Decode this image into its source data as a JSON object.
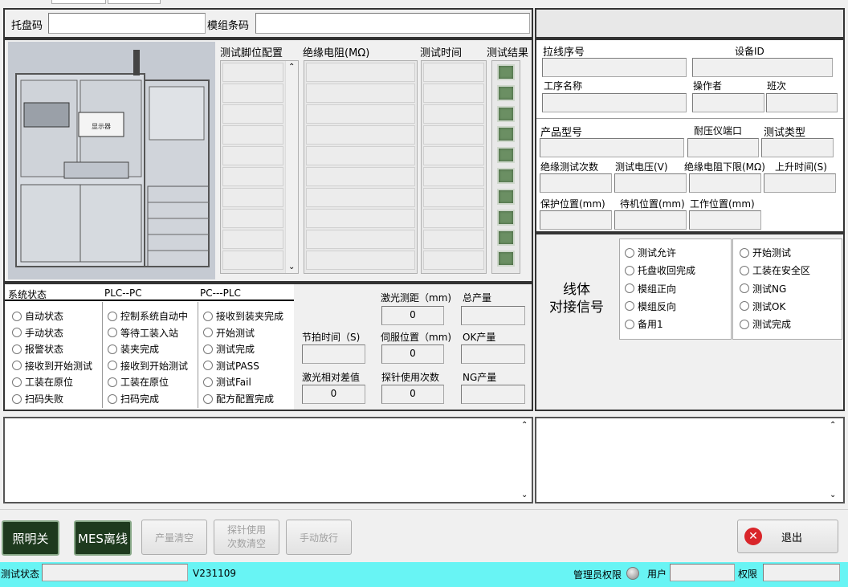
{
  "top": {
    "tray_label": "托盘码",
    "module_label": "模组条码"
  },
  "table": {
    "headers": [
      "测试脚位配置",
      "绝缘电阻(MΩ)",
      "测试时间",
      "测试结果"
    ],
    "rows": 10
  },
  "image": {
    "screen_text": "显示器"
  },
  "status": {
    "col1_title": "系统状态",
    "col2_title": "PLC--PC",
    "col3_title": "PC---PLC",
    "col1": [
      "自动状态",
      "手动状态",
      "报警状态",
      "接收到开始测试",
      "工装在原位",
      "扫码失败"
    ],
    "col2": [
      "控制系统自动中",
      "等待工装入站",
      "装夹完成",
      "接收到开始测试",
      "工装在原位",
      "扫码完成"
    ],
    "col3": [
      "接收到装夹完成",
      "开始测试",
      "测试完成",
      "测试PASS",
      "测试Fail",
      "配方配置完成"
    ]
  },
  "metrics": {
    "beat_label": "节拍时间（S)",
    "beat_value": "",
    "laser_label": "激光测距（mm)",
    "laser_value": "0",
    "total_label": "总产量",
    "total_value": "",
    "servo_label": "伺服位置（mm)",
    "servo_value": "0",
    "ok_label": "OK产量",
    "ok_value": "",
    "laser_diff_label": "激光相对差值",
    "laser_diff_value": "0",
    "probe_label": "探针使用次数",
    "probe_value": "0",
    "ng_label": "NG产量",
    "ng_value": ""
  },
  "info": {
    "line_seq": "拉线序号",
    "device_id": "设备ID",
    "process_name": "工序名称",
    "operator": "操作者",
    "shift": "班次",
    "product_model": "产品型号",
    "hipot_port": "耐压仪端口",
    "test_type": "测试类型",
    "ins_count": "绝缘测试次数",
    "test_voltage": "测试电压(V)",
    "ins_lower": "绝缘电阻下限(MΩ)",
    "rise_time": "上升时间(S)",
    "protect_pos": "保护位置(mm)",
    "standby_pos": "待机位置(mm)",
    "work_pos": "工作位置(mm)"
  },
  "signals": {
    "title_line1": "线体",
    "title_line2": "对接信号",
    "left": [
      "测试允许",
      "托盘收回完成",
      "模组正向",
      "模组反向",
      "备用1"
    ],
    "right": [
      "开始测试",
      "工装在安全区",
      "测试NG",
      "测试OK",
      "测试完成"
    ]
  },
  "buttons": {
    "light": "照明关",
    "mes": "MES离线",
    "clear_output": "产量清空",
    "clear_probe_line1": "探针使用",
    "clear_probe_line2": "次数清空",
    "manual_release": "手动放行",
    "exit": "退出"
  },
  "statusbar": {
    "test_state_label": "测试状态",
    "version": "V231109",
    "admin_label": "管理员权限",
    "user_label": "用户",
    "perm_label": "权限"
  },
  "colors": {
    "statusbar": "#68f4f4",
    "led": "#6b8f63",
    "button_green": "#1e3a1e",
    "exit_icon": "#d9252a"
  }
}
